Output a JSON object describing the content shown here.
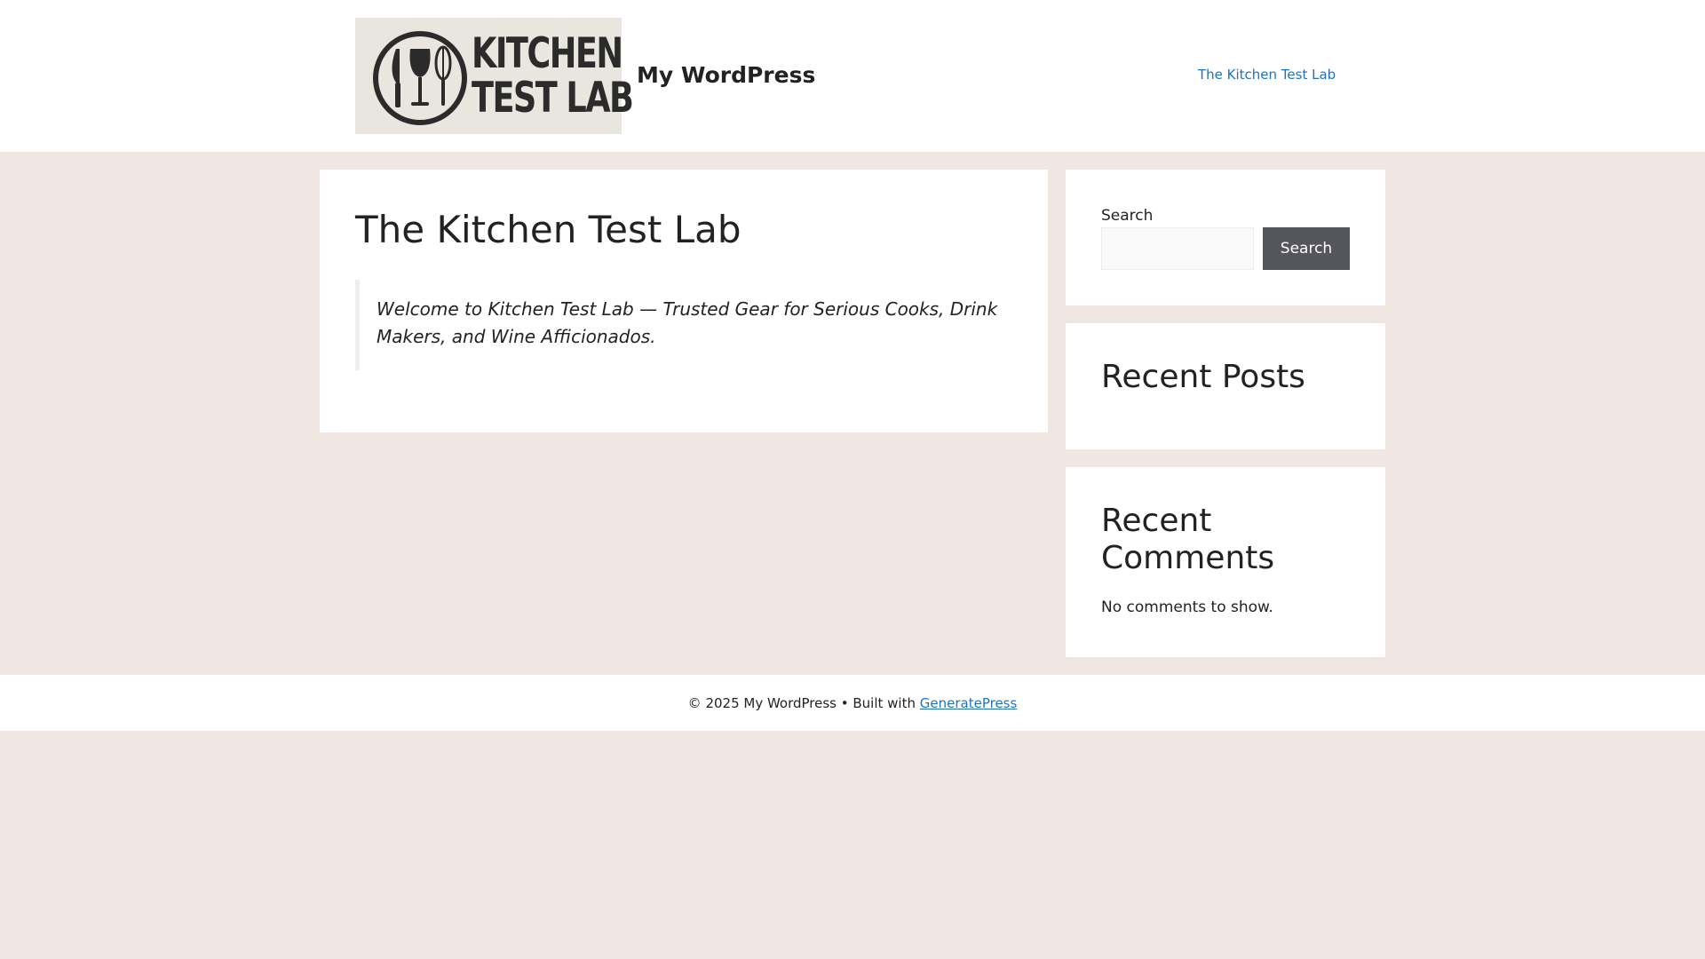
{
  "header": {
    "logo_text_line1": "KITCHEN",
    "logo_text_line2": "TEST LAB",
    "site_title": "My WordPress",
    "nav": [
      {
        "label": "The Kitchen Test Lab"
      }
    ]
  },
  "main": {
    "page_title": "The Kitchen Test Lab",
    "quote": "Welcome to Kitchen Test Lab — Trusted Gear for Serious Cooks, Drink Makers, and Wine Afficionados."
  },
  "sidebar": {
    "search": {
      "label": "Search",
      "input_value": "",
      "button_label": "Search"
    },
    "recent_posts": {
      "title": "Recent Posts"
    },
    "recent_comments": {
      "title": "Recent Comments",
      "empty_text": "No comments to show."
    }
  },
  "footer": {
    "copyright": "© 2025 My WordPress • Built with ",
    "link_label": "GeneratePress"
  },
  "colors": {
    "page_background": "#f1e7e2",
    "link": "#1e73be",
    "button": "#55555e"
  }
}
